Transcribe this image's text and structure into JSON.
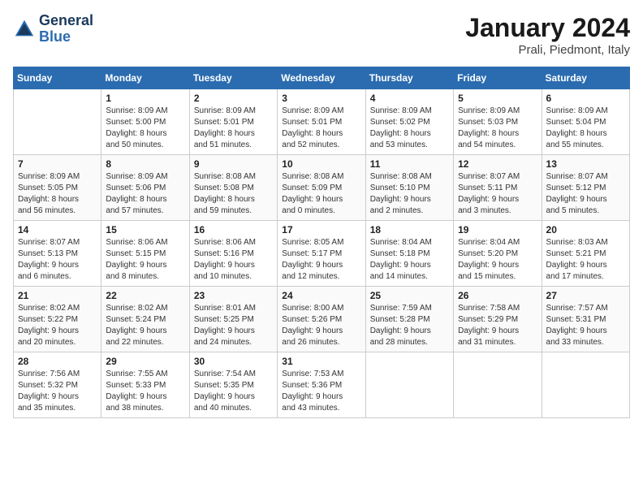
{
  "header": {
    "logo_line1": "General",
    "logo_line2": "Blue",
    "main_title": "January 2024",
    "subtitle": "Prali, Piedmont, Italy"
  },
  "calendar": {
    "columns": [
      "Sunday",
      "Monday",
      "Tuesday",
      "Wednesday",
      "Thursday",
      "Friday",
      "Saturday"
    ],
    "weeks": [
      [
        {
          "day": "",
          "info": ""
        },
        {
          "day": "1",
          "info": "Sunrise: 8:09 AM\nSunset: 5:00 PM\nDaylight: 8 hours\nand 50 minutes."
        },
        {
          "day": "2",
          "info": "Sunrise: 8:09 AM\nSunset: 5:01 PM\nDaylight: 8 hours\nand 51 minutes."
        },
        {
          "day": "3",
          "info": "Sunrise: 8:09 AM\nSunset: 5:01 PM\nDaylight: 8 hours\nand 52 minutes."
        },
        {
          "day": "4",
          "info": "Sunrise: 8:09 AM\nSunset: 5:02 PM\nDaylight: 8 hours\nand 53 minutes."
        },
        {
          "day": "5",
          "info": "Sunrise: 8:09 AM\nSunset: 5:03 PM\nDaylight: 8 hours\nand 54 minutes."
        },
        {
          "day": "6",
          "info": "Sunrise: 8:09 AM\nSunset: 5:04 PM\nDaylight: 8 hours\nand 55 minutes."
        }
      ],
      [
        {
          "day": "7",
          "info": "Sunrise: 8:09 AM\nSunset: 5:05 PM\nDaylight: 8 hours\nand 56 minutes."
        },
        {
          "day": "8",
          "info": "Sunrise: 8:09 AM\nSunset: 5:06 PM\nDaylight: 8 hours\nand 57 minutes."
        },
        {
          "day": "9",
          "info": "Sunrise: 8:08 AM\nSunset: 5:08 PM\nDaylight: 8 hours\nand 59 minutes."
        },
        {
          "day": "10",
          "info": "Sunrise: 8:08 AM\nSunset: 5:09 PM\nDaylight: 9 hours\nand 0 minutes."
        },
        {
          "day": "11",
          "info": "Sunrise: 8:08 AM\nSunset: 5:10 PM\nDaylight: 9 hours\nand 2 minutes."
        },
        {
          "day": "12",
          "info": "Sunrise: 8:07 AM\nSunset: 5:11 PM\nDaylight: 9 hours\nand 3 minutes."
        },
        {
          "day": "13",
          "info": "Sunrise: 8:07 AM\nSunset: 5:12 PM\nDaylight: 9 hours\nand 5 minutes."
        }
      ],
      [
        {
          "day": "14",
          "info": "Sunrise: 8:07 AM\nSunset: 5:13 PM\nDaylight: 9 hours\nand 6 minutes."
        },
        {
          "day": "15",
          "info": "Sunrise: 8:06 AM\nSunset: 5:15 PM\nDaylight: 9 hours\nand 8 minutes."
        },
        {
          "day": "16",
          "info": "Sunrise: 8:06 AM\nSunset: 5:16 PM\nDaylight: 9 hours\nand 10 minutes."
        },
        {
          "day": "17",
          "info": "Sunrise: 8:05 AM\nSunset: 5:17 PM\nDaylight: 9 hours\nand 12 minutes."
        },
        {
          "day": "18",
          "info": "Sunrise: 8:04 AM\nSunset: 5:18 PM\nDaylight: 9 hours\nand 14 minutes."
        },
        {
          "day": "19",
          "info": "Sunrise: 8:04 AM\nSunset: 5:20 PM\nDaylight: 9 hours\nand 15 minutes."
        },
        {
          "day": "20",
          "info": "Sunrise: 8:03 AM\nSunset: 5:21 PM\nDaylight: 9 hours\nand 17 minutes."
        }
      ],
      [
        {
          "day": "21",
          "info": "Sunrise: 8:02 AM\nSunset: 5:22 PM\nDaylight: 9 hours\nand 20 minutes."
        },
        {
          "day": "22",
          "info": "Sunrise: 8:02 AM\nSunset: 5:24 PM\nDaylight: 9 hours\nand 22 minutes."
        },
        {
          "day": "23",
          "info": "Sunrise: 8:01 AM\nSunset: 5:25 PM\nDaylight: 9 hours\nand 24 minutes."
        },
        {
          "day": "24",
          "info": "Sunrise: 8:00 AM\nSunset: 5:26 PM\nDaylight: 9 hours\nand 26 minutes."
        },
        {
          "day": "25",
          "info": "Sunrise: 7:59 AM\nSunset: 5:28 PM\nDaylight: 9 hours\nand 28 minutes."
        },
        {
          "day": "26",
          "info": "Sunrise: 7:58 AM\nSunset: 5:29 PM\nDaylight: 9 hours\nand 31 minutes."
        },
        {
          "day": "27",
          "info": "Sunrise: 7:57 AM\nSunset: 5:31 PM\nDaylight: 9 hours\nand 33 minutes."
        }
      ],
      [
        {
          "day": "28",
          "info": "Sunrise: 7:56 AM\nSunset: 5:32 PM\nDaylight: 9 hours\nand 35 minutes."
        },
        {
          "day": "29",
          "info": "Sunrise: 7:55 AM\nSunset: 5:33 PM\nDaylight: 9 hours\nand 38 minutes."
        },
        {
          "day": "30",
          "info": "Sunrise: 7:54 AM\nSunset: 5:35 PM\nDaylight: 9 hours\nand 40 minutes."
        },
        {
          "day": "31",
          "info": "Sunrise: 7:53 AM\nSunset: 5:36 PM\nDaylight: 9 hours\nand 43 minutes."
        },
        {
          "day": "",
          "info": ""
        },
        {
          "day": "",
          "info": ""
        },
        {
          "day": "",
          "info": ""
        }
      ]
    ]
  }
}
